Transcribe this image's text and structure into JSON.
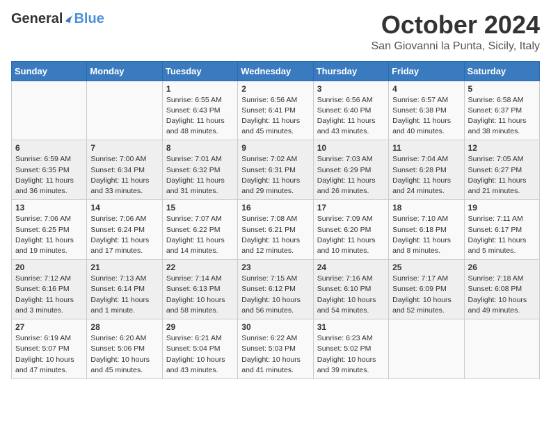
{
  "header": {
    "logo_general": "General",
    "logo_blue": "Blue",
    "month": "October 2024",
    "location": "San Giovanni la Punta, Sicily, Italy"
  },
  "weekdays": [
    "Sunday",
    "Monday",
    "Tuesday",
    "Wednesday",
    "Thursday",
    "Friday",
    "Saturday"
  ],
  "weeks": [
    [
      {
        "day": "",
        "text": ""
      },
      {
        "day": "",
        "text": ""
      },
      {
        "day": "1",
        "text": "Sunrise: 6:55 AM\nSunset: 6:43 PM\nDaylight: 11 hours and 48 minutes."
      },
      {
        "day": "2",
        "text": "Sunrise: 6:56 AM\nSunset: 6:41 PM\nDaylight: 11 hours and 45 minutes."
      },
      {
        "day": "3",
        "text": "Sunrise: 6:56 AM\nSunset: 6:40 PM\nDaylight: 11 hours and 43 minutes."
      },
      {
        "day": "4",
        "text": "Sunrise: 6:57 AM\nSunset: 6:38 PM\nDaylight: 11 hours and 40 minutes."
      },
      {
        "day": "5",
        "text": "Sunrise: 6:58 AM\nSunset: 6:37 PM\nDaylight: 11 hours and 38 minutes."
      }
    ],
    [
      {
        "day": "6",
        "text": "Sunrise: 6:59 AM\nSunset: 6:35 PM\nDaylight: 11 hours and 36 minutes."
      },
      {
        "day": "7",
        "text": "Sunrise: 7:00 AM\nSunset: 6:34 PM\nDaylight: 11 hours and 33 minutes."
      },
      {
        "day": "8",
        "text": "Sunrise: 7:01 AM\nSunset: 6:32 PM\nDaylight: 11 hours and 31 minutes."
      },
      {
        "day": "9",
        "text": "Sunrise: 7:02 AM\nSunset: 6:31 PM\nDaylight: 11 hours and 29 minutes."
      },
      {
        "day": "10",
        "text": "Sunrise: 7:03 AM\nSunset: 6:29 PM\nDaylight: 11 hours and 26 minutes."
      },
      {
        "day": "11",
        "text": "Sunrise: 7:04 AM\nSunset: 6:28 PM\nDaylight: 11 hours and 24 minutes."
      },
      {
        "day": "12",
        "text": "Sunrise: 7:05 AM\nSunset: 6:27 PM\nDaylight: 11 hours and 21 minutes."
      }
    ],
    [
      {
        "day": "13",
        "text": "Sunrise: 7:06 AM\nSunset: 6:25 PM\nDaylight: 11 hours and 19 minutes."
      },
      {
        "day": "14",
        "text": "Sunrise: 7:06 AM\nSunset: 6:24 PM\nDaylight: 11 hours and 17 minutes."
      },
      {
        "day": "15",
        "text": "Sunrise: 7:07 AM\nSunset: 6:22 PM\nDaylight: 11 hours and 14 minutes."
      },
      {
        "day": "16",
        "text": "Sunrise: 7:08 AM\nSunset: 6:21 PM\nDaylight: 11 hours and 12 minutes."
      },
      {
        "day": "17",
        "text": "Sunrise: 7:09 AM\nSunset: 6:20 PM\nDaylight: 11 hours and 10 minutes."
      },
      {
        "day": "18",
        "text": "Sunrise: 7:10 AM\nSunset: 6:18 PM\nDaylight: 11 hours and 8 minutes."
      },
      {
        "day": "19",
        "text": "Sunrise: 7:11 AM\nSunset: 6:17 PM\nDaylight: 11 hours and 5 minutes."
      }
    ],
    [
      {
        "day": "20",
        "text": "Sunrise: 7:12 AM\nSunset: 6:16 PM\nDaylight: 11 hours and 3 minutes."
      },
      {
        "day": "21",
        "text": "Sunrise: 7:13 AM\nSunset: 6:14 PM\nDaylight: 11 hours and 1 minute."
      },
      {
        "day": "22",
        "text": "Sunrise: 7:14 AM\nSunset: 6:13 PM\nDaylight: 10 hours and 58 minutes."
      },
      {
        "day": "23",
        "text": "Sunrise: 7:15 AM\nSunset: 6:12 PM\nDaylight: 10 hours and 56 minutes."
      },
      {
        "day": "24",
        "text": "Sunrise: 7:16 AM\nSunset: 6:10 PM\nDaylight: 10 hours and 54 minutes."
      },
      {
        "day": "25",
        "text": "Sunrise: 7:17 AM\nSunset: 6:09 PM\nDaylight: 10 hours and 52 minutes."
      },
      {
        "day": "26",
        "text": "Sunrise: 7:18 AM\nSunset: 6:08 PM\nDaylight: 10 hours and 49 minutes."
      }
    ],
    [
      {
        "day": "27",
        "text": "Sunrise: 6:19 AM\nSunset: 5:07 PM\nDaylight: 10 hours and 47 minutes."
      },
      {
        "day": "28",
        "text": "Sunrise: 6:20 AM\nSunset: 5:06 PM\nDaylight: 10 hours and 45 minutes."
      },
      {
        "day": "29",
        "text": "Sunrise: 6:21 AM\nSunset: 5:04 PM\nDaylight: 10 hours and 43 minutes."
      },
      {
        "day": "30",
        "text": "Sunrise: 6:22 AM\nSunset: 5:03 PM\nDaylight: 10 hours and 41 minutes."
      },
      {
        "day": "31",
        "text": "Sunrise: 6:23 AM\nSunset: 5:02 PM\nDaylight: 10 hours and 39 minutes."
      },
      {
        "day": "",
        "text": ""
      },
      {
        "day": "",
        "text": ""
      }
    ]
  ]
}
